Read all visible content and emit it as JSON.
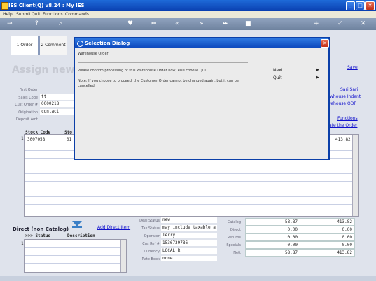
{
  "window": {
    "title": "IES Client(Q) v8.24 : My IES"
  },
  "menu": [
    "Help",
    "Submit",
    "Quit",
    "Functions",
    "Commands"
  ],
  "tabs": [
    {
      "label": "1 Order"
    },
    {
      "label": "2 Comment"
    }
  ],
  "form": {
    "heading": "Assign new C",
    "first_order_label": "First Order",
    "sales_code_label": "Sales Code",
    "sales_code_value": "tt",
    "cust_order_label": "Cust Order #",
    "cust_order_value": "0000218",
    "origination_label": "Origination",
    "origination_value": "contact",
    "deposit_label": "Deposit Amt"
  },
  "right_links": {
    "save": "Save",
    "sari": "Sari Sari",
    "warehouse_indent": "whouse Indent",
    "warehouse_odp": "rehouse ODP",
    "functions": "Functions",
    "rate_order": "ate the Order"
  },
  "grid": {
    "headers": [
      "Stock Code",
      "Sto"
    ],
    "rows": [
      {
        "num": "1",
        "stock_code": "3007058",
        "store": "01",
        "total": "413.82"
      }
    ]
  },
  "direct": {
    "title": "Direct (non Catalog)",
    "add_link": "Add Direct Item",
    "headers": [
      ">>> Status",
      "Description"
    ],
    "row_num": "1"
  },
  "details": {
    "deal_status_label": "Deal Status",
    "deal_status_value": "new",
    "tax_status_label": "Tax Status",
    "tax_status_value": "may include taxable a",
    "operator_label": "Operator",
    "operator_value": "Terry",
    "cust_ref_label": "Cus Ref #",
    "cust_ref_value": "1536739786",
    "currency_label": "Currency",
    "currency_value": "LOCAL R",
    "rate_book_label": "Rate Book",
    "rate_book_value": "none"
  },
  "totals": {
    "labels": [
      "Catalog",
      "Direct",
      "Returns",
      "Specials",
      "Nett"
    ],
    "col1": [
      "58.87",
      "0.00",
      "0.00",
      "0.00",
      "58.87"
    ],
    "col2": [
      "413.82",
      "0.00",
      "0.00",
      "0.00",
      "413.82"
    ]
  },
  "dialog": {
    "title": "Selection Dialog",
    "subtitle": "Warehouse Order",
    "message": "Please confirm processing of this Warehouse Order now, else choose QUIT.",
    "note": "Note: If you choose to proceed, the Customer Order cannot be changed again, but it can be cancelled.",
    "options": [
      {
        "label": "Next"
      },
      {
        "label": "Quit"
      }
    ]
  },
  "colors": {
    "title_blue": "#0b46bb",
    "link_blue": "#1111cc",
    "toolbar": "#7f93b0"
  }
}
